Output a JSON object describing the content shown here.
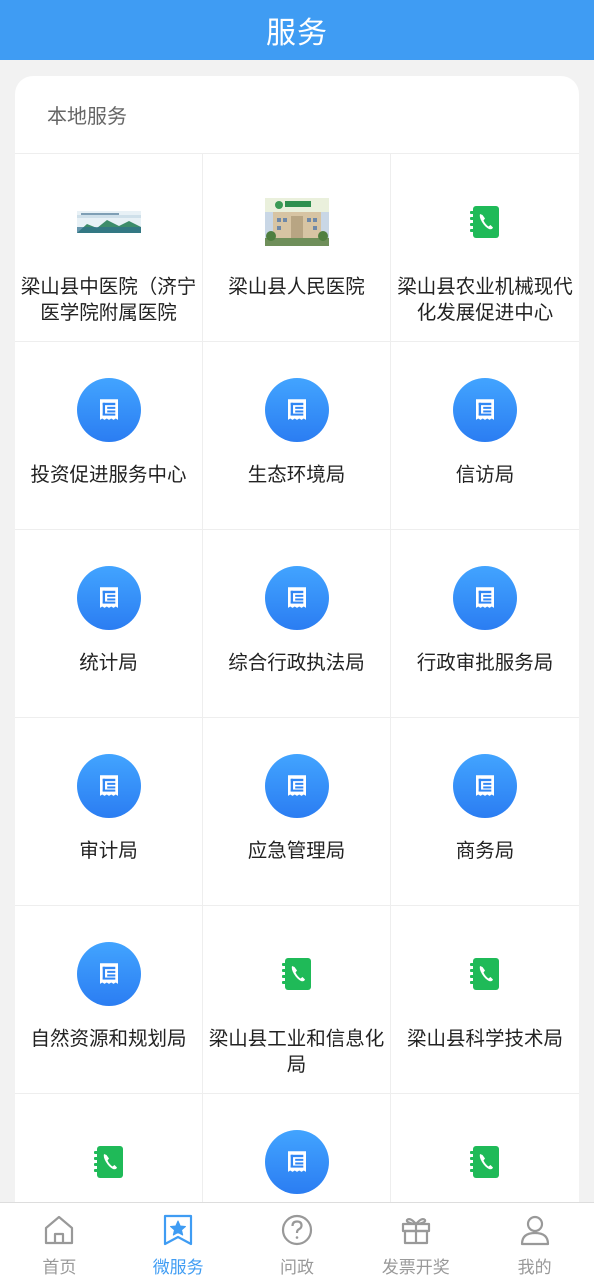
{
  "header": {
    "title": "服务"
  },
  "section": {
    "title": "本地服务"
  },
  "services": [
    {
      "label": "梁山县中医院（济宁医学院附属医院",
      "icon": "hospital-photo-icon",
      "kind": "photo1"
    },
    {
      "label": "梁山县人民医院",
      "icon": "hospital-building-photo-icon",
      "kind": "photo2"
    },
    {
      "label": "梁山县农业机械现代化发展促进中心",
      "icon": "phone-book-icon",
      "kind": "green"
    },
    {
      "label": "投资促进服务中心",
      "icon": "document-icon",
      "kind": "blue"
    },
    {
      "label": "生态环境局",
      "icon": "document-icon",
      "kind": "blue"
    },
    {
      "label": "信访局",
      "icon": "document-icon",
      "kind": "blue"
    },
    {
      "label": "统计局",
      "icon": "document-icon",
      "kind": "blue"
    },
    {
      "label": "综合行政执法局",
      "icon": "document-icon",
      "kind": "blue"
    },
    {
      "label": "行政审批服务局",
      "icon": "document-icon",
      "kind": "blue"
    },
    {
      "label": "审计局",
      "icon": "document-icon",
      "kind": "blue"
    },
    {
      "label": "应急管理局",
      "icon": "document-icon",
      "kind": "blue"
    },
    {
      "label": "商务局",
      "icon": "document-icon",
      "kind": "blue"
    },
    {
      "label": "自然资源和规划局",
      "icon": "document-icon",
      "kind": "blue"
    },
    {
      "label": "梁山县工业和信息化局",
      "icon": "phone-book-icon",
      "kind": "green"
    },
    {
      "label": "梁山县科学技术局",
      "icon": "phone-book-icon",
      "kind": "green"
    },
    {
      "label": "",
      "icon": "phone-book-icon",
      "kind": "green"
    },
    {
      "label": "",
      "icon": "document-icon",
      "kind": "blue"
    },
    {
      "label": "",
      "icon": "phone-book-icon",
      "kind": "green"
    }
  ],
  "tabbar": {
    "items": [
      {
        "label": "首页",
        "icon": "home-icon"
      },
      {
        "label": "微服务",
        "icon": "star-bookmark-icon"
      },
      {
        "label": "问政",
        "icon": "question-icon"
      },
      {
        "label": "发票开奖",
        "icon": "gift-icon"
      },
      {
        "label": "我的",
        "icon": "user-icon"
      }
    ],
    "active": "微服务"
  },
  "colors": {
    "header": "#3f9cf3",
    "accent": "#3f9cf3",
    "green": "#1fba58"
  }
}
